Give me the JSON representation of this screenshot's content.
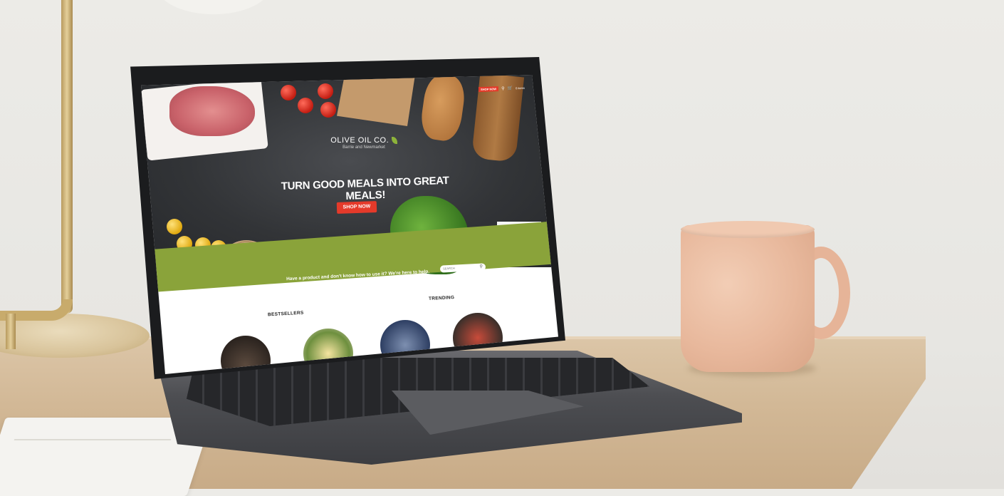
{
  "site": {
    "logo": {
      "name": "OLIVE OIL CO.",
      "subtitle": "Barrie and Newmarket"
    },
    "topbar": {
      "shop_now": "SHOP NOW",
      "cart_items": "0 items"
    },
    "hero": {
      "headline": "TURN GOOD MEALS INTO GREAT MEALS!",
      "cta": "SHOP NOW"
    },
    "help": {
      "text": "Have a product and don't know how to use it? We're here to help.",
      "search_placeholder": "SEARCH"
    },
    "sections": {
      "bestsellers": "BESTSELLERS",
      "trending": "TRENDING"
    }
  },
  "icons": {
    "search": "search-icon",
    "cart": "cart-icon",
    "leaf": "olive-leaf-icon"
  },
  "colors": {
    "accent_red": "#e53a2a",
    "olive_green": "#8aa33a"
  }
}
